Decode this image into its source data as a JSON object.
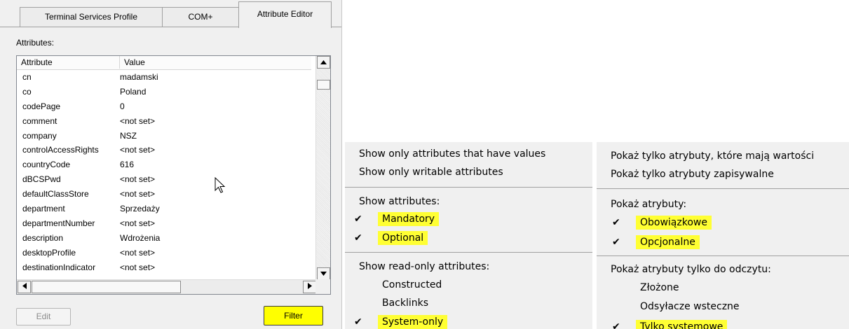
{
  "dialog": {
    "tabs": [
      "Terminal Services Profile",
      "COM+",
      "Attribute Editor"
    ],
    "attributes_label": "Attributes:",
    "columns": [
      "Attribute",
      "Value"
    ],
    "rows": [
      {
        "attribute": "cn",
        "value": "madamski"
      },
      {
        "attribute": "co",
        "value": "Poland"
      },
      {
        "attribute": "codePage",
        "value": "0"
      },
      {
        "attribute": "comment",
        "value": "<not set>"
      },
      {
        "attribute": "company",
        "value": "NSZ"
      },
      {
        "attribute": "controlAccessRights",
        "value": "<not set>"
      },
      {
        "attribute": "countryCode",
        "value": "616"
      },
      {
        "attribute": "dBCSPwd",
        "value": "<not set>"
      },
      {
        "attribute": "defaultClassStore",
        "value": "<not set>"
      },
      {
        "attribute": "department",
        "value": "Sprzedaży"
      },
      {
        "attribute": "departmentNumber",
        "value": "<not set>"
      },
      {
        "attribute": "description",
        "value": "Wdrożenia"
      },
      {
        "attribute": "desktopProfile",
        "value": "<not set>"
      },
      {
        "attribute": "destinationIndicator",
        "value": "<not set>"
      }
    ],
    "edit_label": "Edit",
    "filter_label": "Filter"
  },
  "menu_en": {
    "show_values": "Show only attributes that have values",
    "show_writable": "Show only writable attributes",
    "show_attrs_header": "Show attributes:",
    "mandatory": "Mandatory",
    "optional": "Optional",
    "readonly_header": "Show read-only attributes:",
    "constructed": "Constructed",
    "backlinks": "Backlinks",
    "system_only": "System-only"
  },
  "menu_pl": {
    "show_values": "Pokaż tylko atrybuty, które mają wartości",
    "show_writable": "Pokaż tylko atrybuty zapisywalne",
    "show_attrs_header": "Pokaż atrybuty:",
    "mandatory": "Obowiązkowe",
    "optional": "Opcjonalne",
    "readonly_header": "Pokaż atrybuty tylko do odczytu:",
    "constructed": "Złożone",
    "backlinks": "Odsyłacze wsteczne",
    "system_only": "Tylko systemowe"
  },
  "colors": {
    "highlight": "#ffff33",
    "dialog_bg": "#f0f0f0"
  }
}
